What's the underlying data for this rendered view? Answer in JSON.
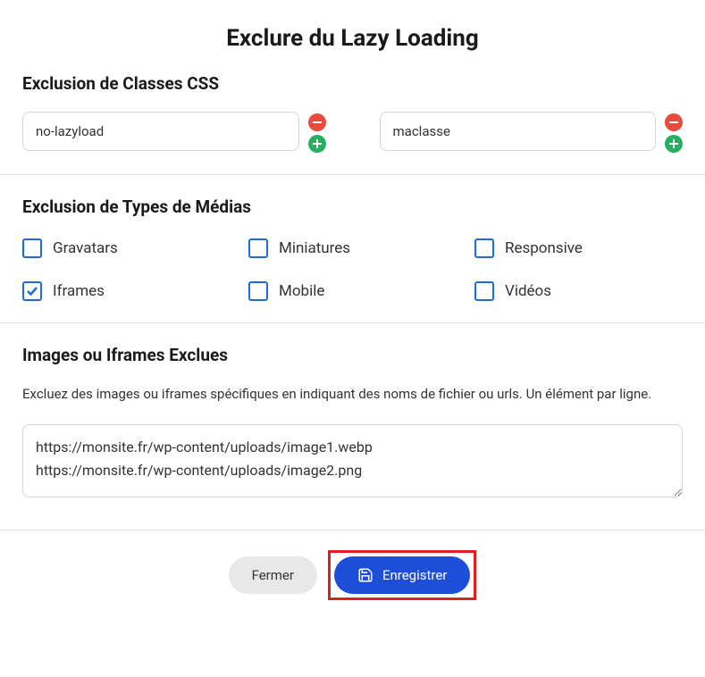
{
  "header": {
    "title": "Exclure du Lazy Loading"
  },
  "css_section": {
    "title": "Exclusion de Classes CSS",
    "inputs": [
      {
        "value": "no-lazyload"
      },
      {
        "value": "maclasse"
      }
    ]
  },
  "media_section": {
    "title": "Exclusion de Types de Médias",
    "options": [
      {
        "label": "Gravatars",
        "checked": false
      },
      {
        "label": "Miniatures",
        "checked": false
      },
      {
        "label": "Responsive",
        "checked": false
      },
      {
        "label": "Iframes",
        "checked": true
      },
      {
        "label": "Mobile",
        "checked": false
      },
      {
        "label": "Vidéos",
        "checked": false
      }
    ]
  },
  "images_section": {
    "title": "Images ou Iframes Exclues",
    "description": "Excluez des images ou iframes spécifiques en indiquant des noms de fichier ou urls. Un élément par ligne.",
    "textarea_value": "https://monsite.fr/wp-content/uploads/image1.webp\nhttps://monsite.fr/wp-content/uploads/image2.png"
  },
  "footer": {
    "close_label": "Fermer",
    "save_label": "Enregistrer"
  }
}
